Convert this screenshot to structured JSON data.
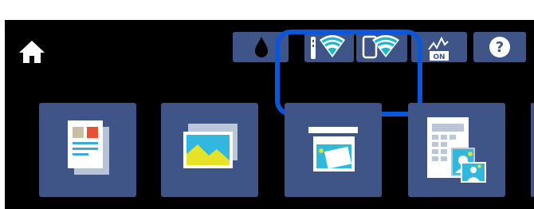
{
  "status_bar": {
    "home": {
      "icon": "home-icon"
    },
    "buttons": [
      {
        "name": "ink-level",
        "icon": "ink-drop-icon"
      },
      {
        "name": "network-status",
        "icon": "wifi-router-icon"
      },
      {
        "name": "wifi-direct-status",
        "icon": "wifi-direct-icon"
      },
      {
        "name": "device-connection",
        "icon": "waveform-on-icon",
        "label": "ON"
      },
      {
        "name": "help",
        "icon": "help-icon",
        "label": "?"
      }
    ],
    "highlight_color": "#0b56d9"
  },
  "tiles": [
    {
      "name": "copy",
      "icon": "copy-document-icon"
    },
    {
      "name": "print-photos",
      "icon": "photos-icon"
    },
    {
      "name": "scan",
      "icon": "scan-icon"
    },
    {
      "name": "photo-id",
      "icon": "photo-layout-icon"
    }
  ],
  "colors": {
    "background": "#000000",
    "tile": "#3f5487",
    "accent": "#0b56d9"
  }
}
